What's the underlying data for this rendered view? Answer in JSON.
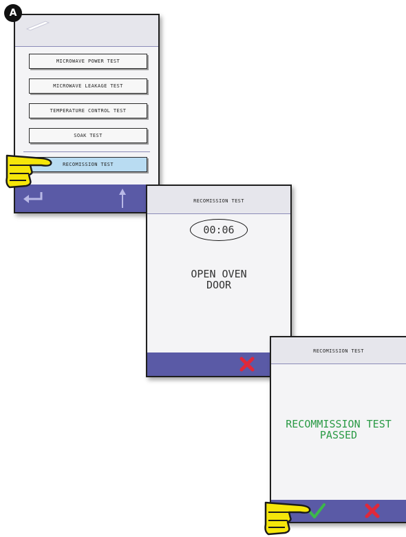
{
  "badge": "A",
  "screen_a": {
    "menu": [
      "MICROWAVE POWER TEST",
      "MICROWAVE LEAKAGE TEST",
      "TEMPERATURE CONTROL TEST",
      "SOAK TEST"
    ],
    "selected": "RECOMISSION TEST"
  },
  "screen_b": {
    "title": "RECOMISSION TEST",
    "timer": "00:06",
    "message": "OPEN OVEN\nDOOR"
  },
  "screen_c": {
    "title": "RECOMISSION TEST",
    "message": "RECOMMISSION TEST\nPASSED"
  },
  "icons": {
    "back": "back-arrow-icon",
    "up": "up-arrow-icon",
    "cancel": "cancel-x-icon",
    "confirm": "checkmark-icon",
    "pointer": "pointing-hand-icon",
    "stylus": "stylus-icon"
  },
  "colors": {
    "bottom_bar": "#5a5aa6",
    "highlight": "#b9dcf2",
    "success_text": "#2a9a45",
    "cancel_red": "#e0283a",
    "confirm_green": "#3cb84a",
    "hand_yellow": "#f5e60a"
  }
}
